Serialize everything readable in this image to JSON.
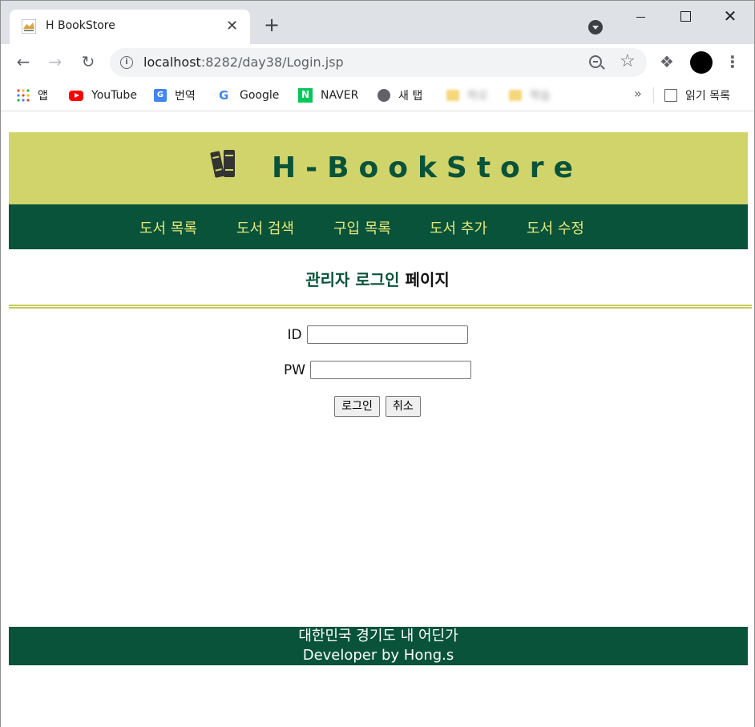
{
  "browser": {
    "tab_title": "H BookStore",
    "tab_close": "✕",
    "new_tab": "+",
    "url_host": "localhost",
    "url_rest": ":8282/day38/Login.jsp",
    "close_glyph": "✕",
    "menu_glyph": "⋮",
    "more_glyph": "»"
  },
  "bookmarks": [
    {
      "label": "앱",
      "icon": "apps-grid-icon"
    },
    {
      "label": "YouTube",
      "icon": "youtube-icon"
    },
    {
      "label": "번역",
      "icon": "google-translate-icon"
    },
    {
      "label": "Google",
      "icon": "google-icon"
    },
    {
      "label": "NAVER",
      "icon": "naver-icon"
    },
    {
      "label": "새 탭",
      "icon": "globe-icon"
    },
    {
      "label": "하오",
      "icon": "folder-icon"
    },
    {
      "label": "학습",
      "icon": "folder-icon"
    }
  ],
  "reading_list": "읽기 목록",
  "site": {
    "title": "H-BookStore",
    "nav": [
      "도서 목록",
      "도서 검색",
      "구입 목록",
      "도서 추가",
      "도서 수정"
    ],
    "heading_part1": "관리자 로그인",
    "heading_part2": " 페이지",
    "id_label": "ID",
    "pw_label": "PW",
    "id_value": "",
    "pw_value": "",
    "login_button": "로그인",
    "cancel_button": "취소",
    "footer_line1": "대한민국 경기도 내 어딘가",
    "footer_line2": "Developer by Hong.s"
  },
  "colors": {
    "header_bg": "#d1d46a",
    "nav_bg": "#08533a",
    "nav_text": "#e6e87a",
    "title_text": "#08533a"
  }
}
